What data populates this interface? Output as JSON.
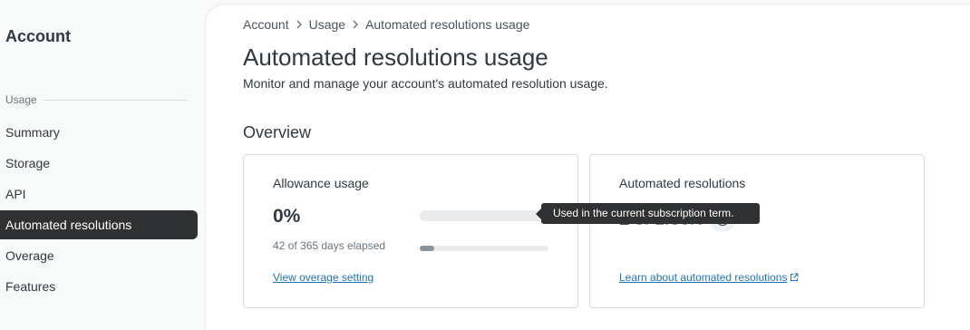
{
  "sidebar": {
    "title": "Account",
    "section_label": "Usage",
    "items": [
      {
        "label": "Summary"
      },
      {
        "label": "Storage"
      },
      {
        "label": "API"
      },
      {
        "label": "Automated resolutions"
      },
      {
        "label": "Overage"
      },
      {
        "label": "Features"
      }
    ],
    "active_index": 3
  },
  "breadcrumb": [
    "Account",
    "Usage",
    "Automated resolutions usage"
  ],
  "page": {
    "title": "Automated resolutions usage",
    "description": "Monitor and manage your account's automated resolution usage."
  },
  "overview": {
    "title": "Overview",
    "allowance": {
      "label": "Allowance usage",
      "percent_text": "0%",
      "usage_fraction": 0.0,
      "days_text": "42 of 365 days elapsed",
      "days_fraction": 0.115,
      "link": "View overage setting"
    },
    "automated": {
      "label": "Automated resolutions",
      "count": "2",
      "of_text": "of 1.86K",
      "link": "Learn about automated resolutions",
      "tooltip": "Used in the current subscription term."
    }
  },
  "icons": {
    "breadcrumb_separator": "chevron-right-icon",
    "info": "info-icon",
    "external_link": "external-link-icon"
  },
  "colors": {
    "active_nav": "#2f3133",
    "link": "#1f73b7",
    "progress_fill": "#87929d",
    "progress_track": "#e9ebed"
  }
}
